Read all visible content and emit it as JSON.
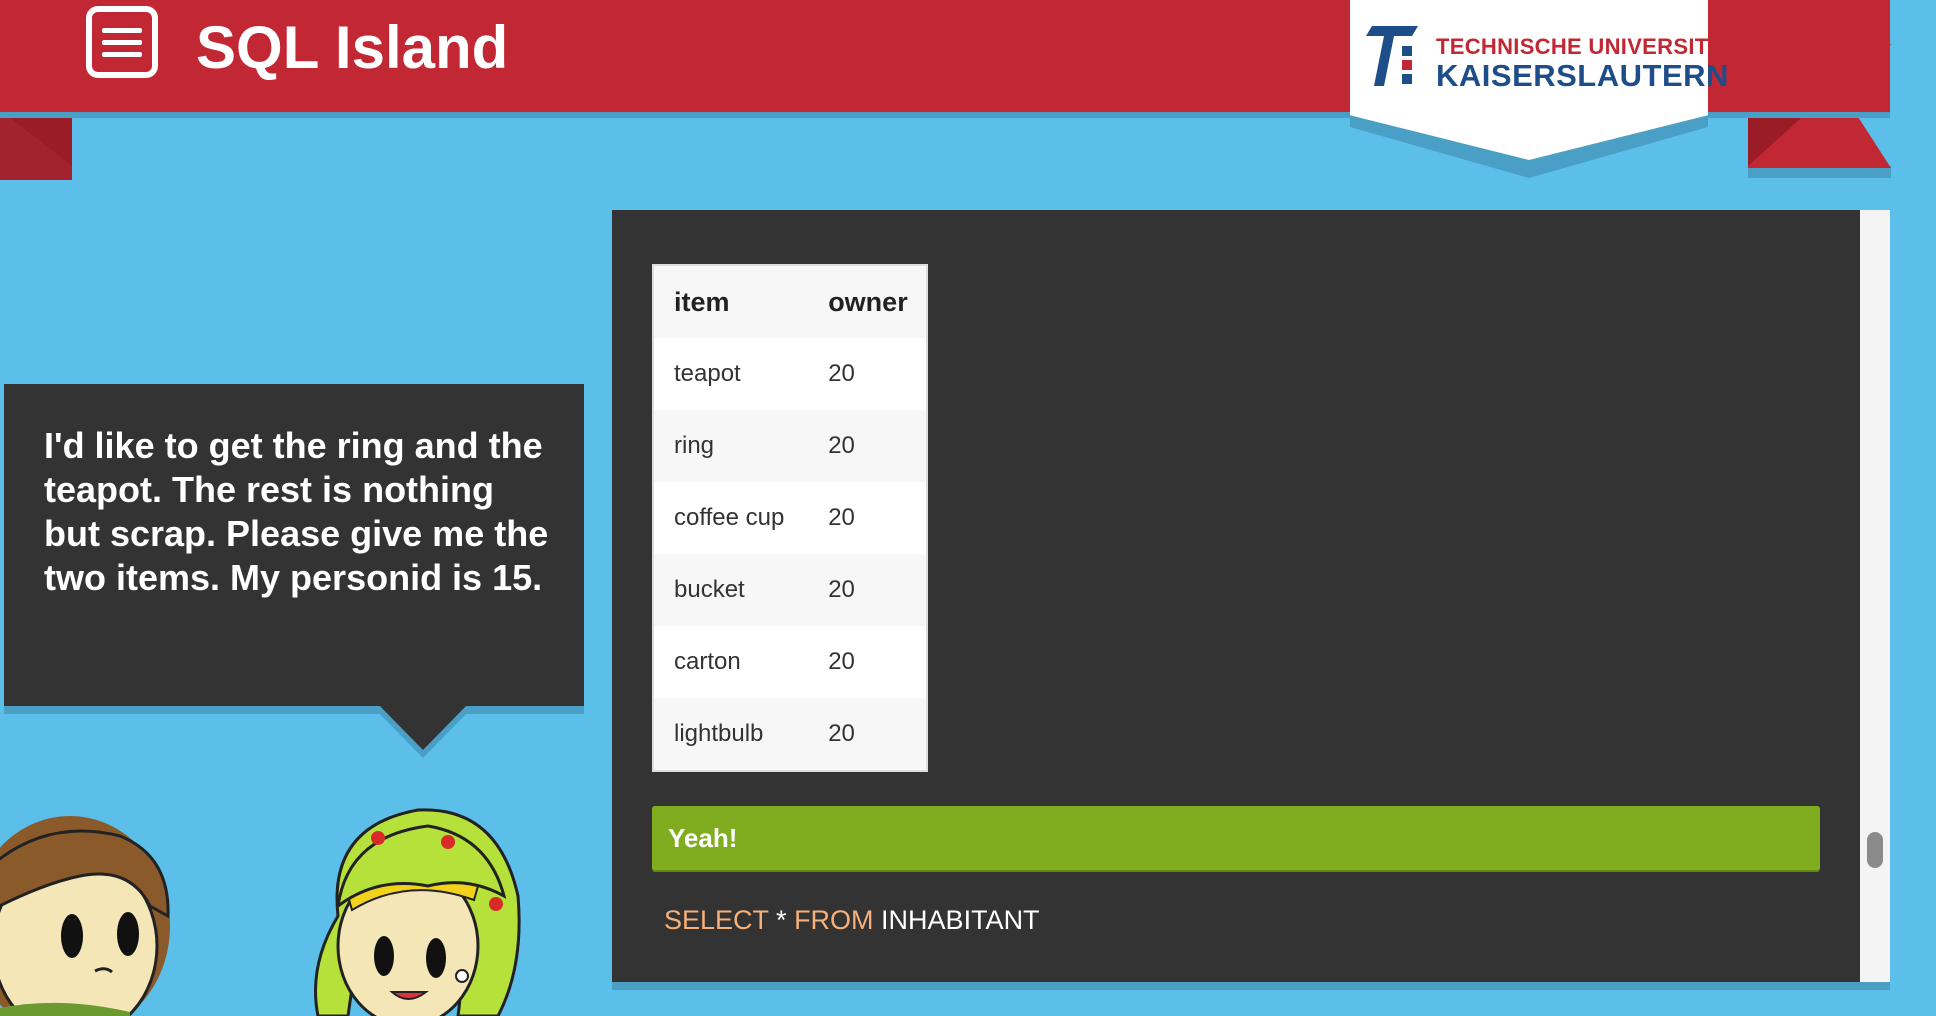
{
  "header": {
    "menu_icon": "hamburger-menu-icon",
    "title": "SQL Island",
    "university": {
      "line1": "TECHNISCHE UNIVERSITÄT",
      "line2": "KAISERSLAUTERN"
    }
  },
  "dialogue": {
    "text": "I'd like to get the ring and the teapot. The rest is nothing but scrap. Please give me the two items. My personid is 15."
  },
  "result": {
    "columns": [
      "item",
      "owner"
    ],
    "rows": [
      [
        "teapot",
        "20"
      ],
      [
        "ring",
        "20"
      ],
      [
        "coffee cup",
        "20"
      ],
      [
        "bucket",
        "20"
      ],
      [
        "carton",
        "20"
      ],
      [
        "lightbulb",
        "20"
      ]
    ]
  },
  "status": {
    "message": "Yeah!",
    "color": "#7fad1f"
  },
  "query": {
    "kw_select": "SELECT",
    "star": " * ",
    "kw_from": "FROM",
    "table": " INHABITANT"
  },
  "colors": {
    "background": "#5bbfea",
    "ribbon": "#c22734",
    "panel": "#333333",
    "keyword": "#f8b07a"
  }
}
